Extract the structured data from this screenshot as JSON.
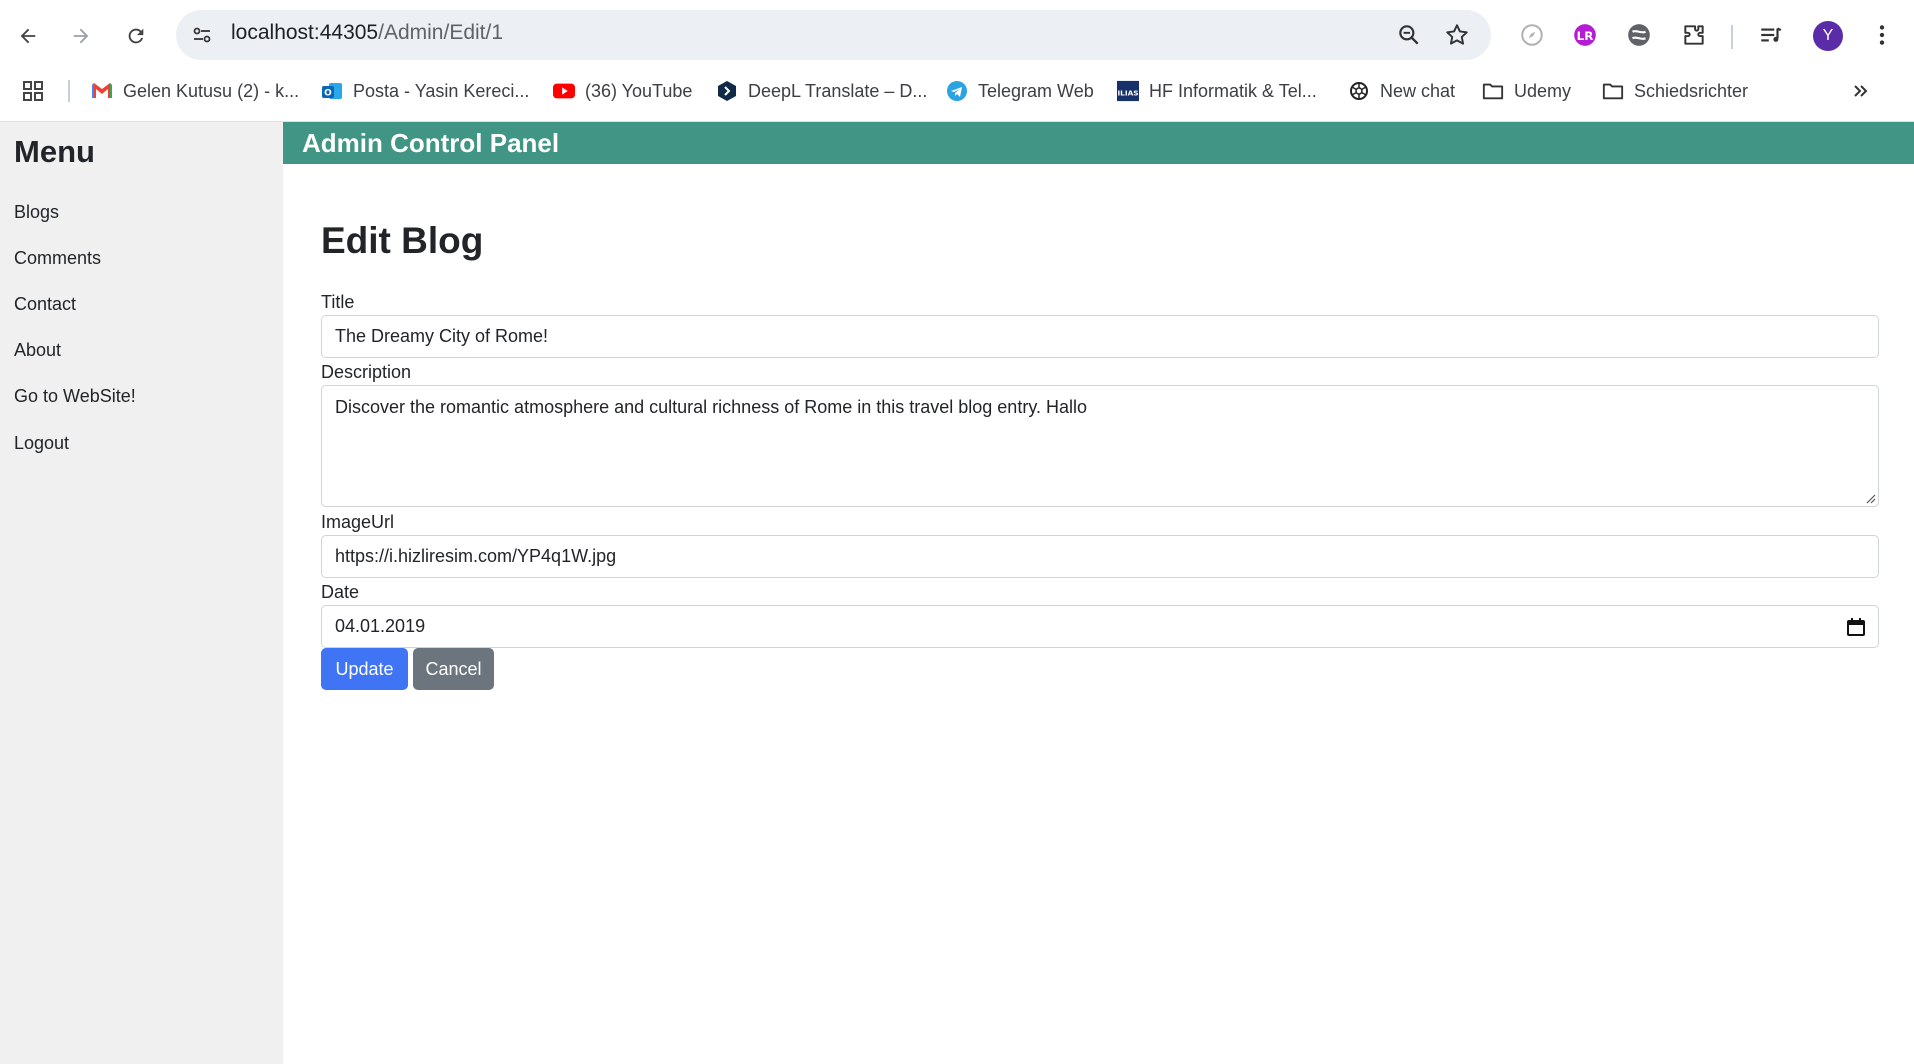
{
  "browser": {
    "url_host": "localhost:44305",
    "url_path": "/Admin/Edit/1",
    "avatar_letter": "Y",
    "bookmarks": [
      {
        "label": "Gelen Kutusu (2) - k...",
        "icon": "gmail-icon"
      },
      {
        "label": "Posta - Yasin Kereci...",
        "icon": "outlook-icon"
      },
      {
        "label": "(36) YouTube",
        "icon": "youtube-icon"
      },
      {
        "label": "DeepL Translate – D...",
        "icon": "deepl-icon"
      },
      {
        "label": "Telegram Web",
        "icon": "telegram-icon"
      },
      {
        "label": "HF Informatik & Tel...",
        "icon": "ilias-icon"
      },
      {
        "label": "New chat",
        "icon": "openai-icon"
      },
      {
        "label": "Udemy",
        "icon": "folder-icon"
      },
      {
        "label": "Schiedsrichter",
        "icon": "folder-icon"
      }
    ],
    "colors": {
      "accent": "#409584",
      "primary": "#3f74f5",
      "secondary": "#6c757d",
      "sidebar": "#f0f0f0"
    }
  },
  "sidebar": {
    "title": "Menu",
    "items": [
      "Blogs",
      "Comments",
      "Contact",
      "About",
      "Go to WebSite!",
      "Logout"
    ]
  },
  "header": {
    "title": "Admin Control Panel"
  },
  "form": {
    "heading": "Edit Blog",
    "title_label": "Title",
    "title_value": "The Dreamy City of Rome!",
    "description_label": "Description",
    "description_value": "Discover the romantic atmosphere and cultural richness of Rome in this travel blog entry. Hallo",
    "imageurl_label": "ImageUrl",
    "imageurl_value": "https://i.hizliresim.com/YP4q1W.jpg",
    "date_label": "Date",
    "date_value": "04.01.2019",
    "update_label": "Update",
    "cancel_label": "Cancel"
  }
}
